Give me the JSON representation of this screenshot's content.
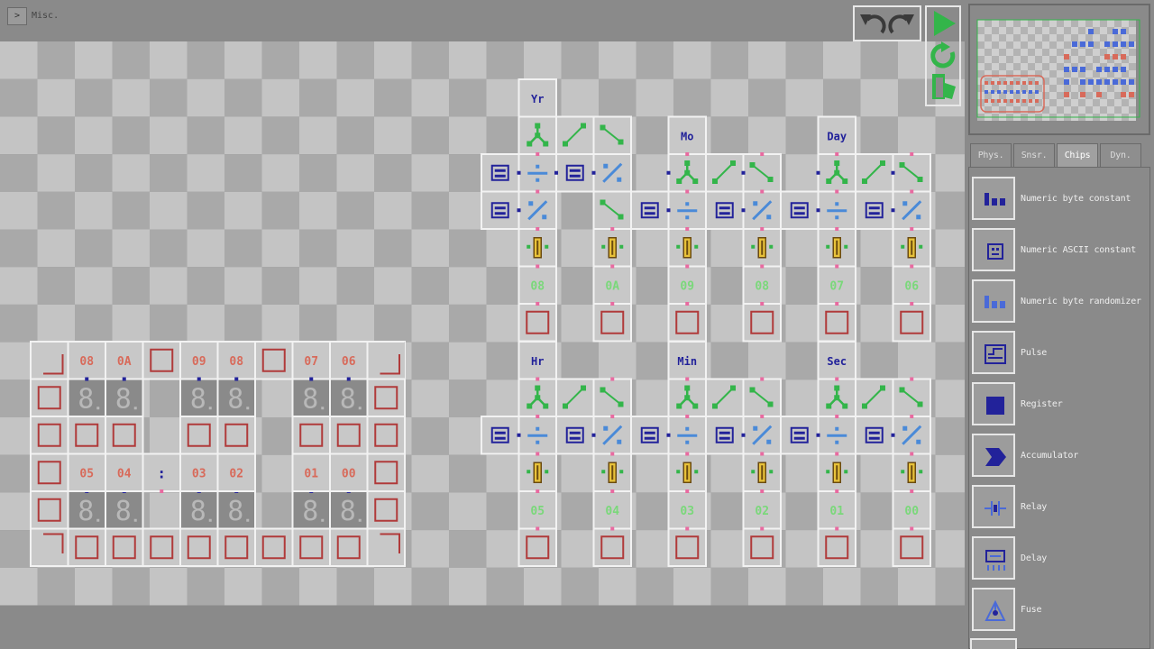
{
  "app": {
    "menu_button": ">",
    "menu_label": "Misc."
  },
  "colors": {
    "accent_green": "#33b54a",
    "chip_blue": "#22229a",
    "led_green": "#7ad87a",
    "led_red": "#d86a5a",
    "frame_red": "#b03a3a"
  },
  "toolbar": {
    "undo_icon": "undo-arrow-icon",
    "redo_icon": "redo-arrow-icon",
    "play_icon": "play-triangle-icon",
    "reset_icon": "reset-circle-icon",
    "exit_icon": "exit-door-icon"
  },
  "tabs": [
    {
      "label": "Phys.",
      "active": false
    },
    {
      "label": "Snsr.",
      "active": false
    },
    {
      "label": "Chips",
      "active": true
    },
    {
      "label": "Dyn.",
      "active": false
    }
  ],
  "components": [
    {
      "label": "Numeric byte constant",
      "icon": "byte-constant-icon"
    },
    {
      "label": "Numeric ASCII constant",
      "icon": "ascii-constant-icon"
    },
    {
      "label": "Numeric byte randomizer",
      "icon": "byte-randomizer-icon"
    },
    {
      "label": "Pulse",
      "icon": "pulse-icon"
    },
    {
      "label": "Register",
      "icon": "register-icon"
    },
    {
      "label": "Accumulator",
      "icon": "accumulator-icon"
    },
    {
      "label": "Relay",
      "icon": "relay-icon"
    },
    {
      "label": "Delay",
      "icon": "delay-icon"
    },
    {
      "label": "Fuse",
      "icon": "fuse-icon"
    }
  ],
  "circuit": {
    "top_headers": [
      "Yr",
      "Mo",
      "Day"
    ],
    "bottom_headers": [
      "Hr",
      "Min",
      "Sec"
    ],
    "top_values": [
      "08",
      "0A",
      "09",
      "08",
      "07",
      "06"
    ],
    "bottom_values": [
      "05",
      "04",
      "03",
      "02",
      "01",
      "00"
    ]
  },
  "clock": {
    "top_values": [
      "08",
      "0A",
      "09",
      "08",
      "07",
      "06"
    ],
    "bottom_values": [
      "05",
      "04",
      "03",
      "02",
      "01",
      "00"
    ],
    "separator": ":",
    "digit_glyph": "8"
  }
}
